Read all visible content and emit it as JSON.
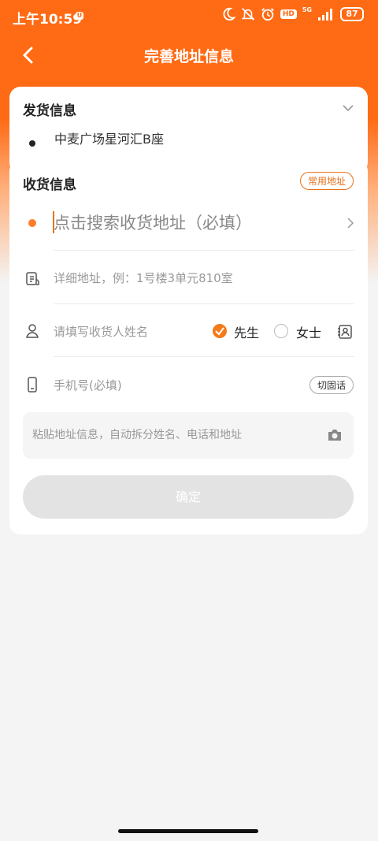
{
  "status_bar": {
    "time": "上午10:59",
    "notif_badge": "U",
    "icons": [
      "moon-icon",
      "mute-icon",
      "alarm-icon",
      "hd-icon",
      "signal-icon",
      "battery-icon"
    ],
    "hd": "HD",
    "network": "5G",
    "battery": "87"
  },
  "header": {
    "title": "完善地址信息",
    "back_icon": "chevron-left-icon"
  },
  "sender": {
    "title": "发货信息",
    "address": "中麦广场星河汇B座"
  },
  "receiver": {
    "title": "收货信息",
    "common_address_label": "常用地址",
    "search_placeholder": "点击搜索收货地址（必填）",
    "detail_placeholder": "详细地址，例：1号楼3单元810室",
    "name_placeholder": "请填写收货人姓名",
    "gender_options": [
      "先生",
      "女士"
    ],
    "gender_selected": "先生",
    "phone_placeholder": "手机号(必填)",
    "switch_landline_label": "切固话",
    "paste_placeholder": "粘贴地址信息，自动拆分姓名、电话和地址",
    "confirm_label": "确定"
  },
  "colors": {
    "brand": "#ff6a14",
    "accent": "#f47a1a",
    "button_disabled": "#e3e3e3"
  }
}
